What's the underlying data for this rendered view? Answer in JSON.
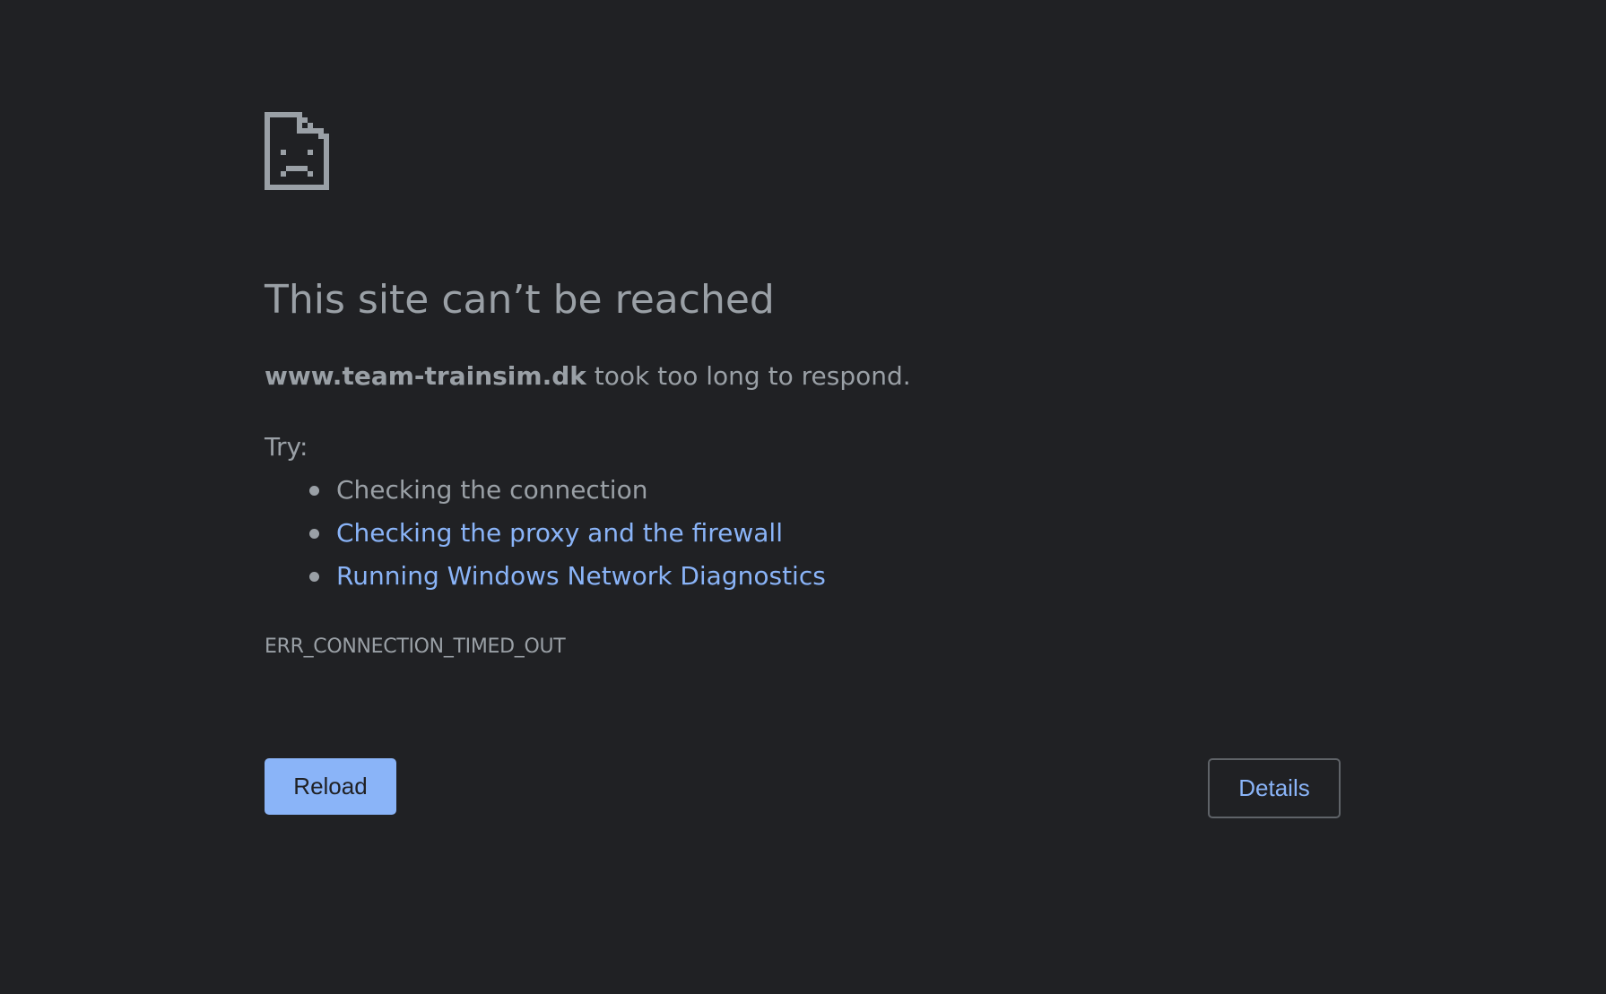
{
  "icons": {
    "error_page": "sad-document-icon"
  },
  "page": {
    "title": "This site can’t be reached",
    "host": "www.team-trainsim.dk",
    "message_rest": " took too long to respond.",
    "try_label": "Try:",
    "suggestions": [
      {
        "text": "Checking the connection",
        "link": false
      },
      {
        "text": "Checking the proxy and the firewall",
        "link": true
      },
      {
        "text": "Running Windows Network Diagnostics",
        "link": true
      }
    ],
    "error_code": "ERR_CONNECTION_TIMED_OUT"
  },
  "buttons": {
    "reload_label": "Reload",
    "details_label": "Details"
  },
  "colors": {
    "background": "#202124",
    "text": "#9aa0a6",
    "link": "#8ab4f8",
    "primary_button": "#8ab4f8",
    "outline": "#5f6368"
  }
}
